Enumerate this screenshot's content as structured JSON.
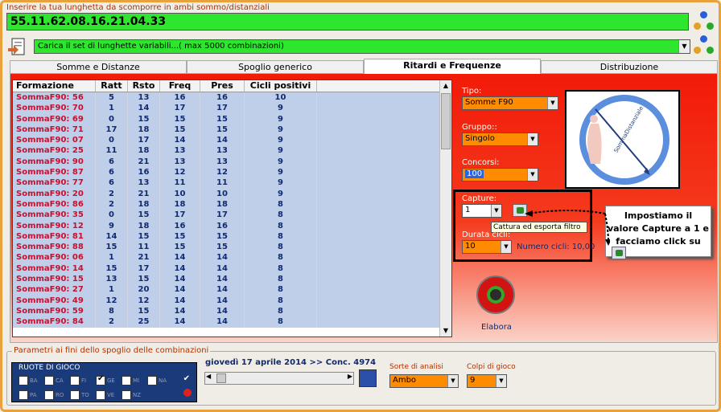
{
  "header": {
    "input_label": "Inserire la tua lunghetta da scomporre in ambi sommo/distanziali",
    "sequence_value": "55.11.62.08.16.21.04.33",
    "combo_value": "Carica il set di lunghette variabili...( max 5000 combinazioni)"
  },
  "tabs": [
    {
      "label": "Somme e Distanze"
    },
    {
      "label": "Spoglio generico"
    },
    {
      "label": "Ritardi e Frequenze"
    },
    {
      "label": "Distribuzione"
    }
  ],
  "table": {
    "columns": [
      "Formazione",
      "Ratt",
      "Rsto",
      "Freq",
      "Pres",
      "Cicli positivi"
    ],
    "rows": [
      [
        "SommaF90: 56",
        "5",
        "13",
        "16",
        "16",
        "10"
      ],
      [
        "SommaF90: 70",
        "1",
        "14",
        "17",
        "17",
        "9"
      ],
      [
        "SommaF90: 69",
        "0",
        "15",
        "15",
        "15",
        "9"
      ],
      [
        "SommaF90: 71",
        "17",
        "18",
        "15",
        "15",
        "9"
      ],
      [
        "SommaF90: 07",
        "0",
        "17",
        "14",
        "14",
        "9"
      ],
      [
        "SommaF90: 25",
        "11",
        "18",
        "13",
        "13",
        "9"
      ],
      [
        "SommaF90: 90",
        "6",
        "21",
        "13",
        "13",
        "9"
      ],
      [
        "SommaF90: 87",
        "6",
        "16",
        "12",
        "12",
        "9"
      ],
      [
        "SommaF90: 77",
        "6",
        "13",
        "11",
        "11",
        "9"
      ],
      [
        "SommaF90: 20",
        "2",
        "21",
        "10",
        "10",
        "9"
      ],
      [
        "SommaF90: 86",
        "2",
        "18",
        "18",
        "18",
        "8"
      ],
      [
        "SommaF90: 35",
        "0",
        "15",
        "17",
        "17",
        "8"
      ],
      [
        "SommaF90: 12",
        "9",
        "18",
        "16",
        "16",
        "8"
      ],
      [
        "SommaF90: 81",
        "14",
        "15",
        "15",
        "15",
        "8"
      ],
      [
        "SommaF90: 88",
        "15",
        "11",
        "15",
        "15",
        "8"
      ],
      [
        "SommaF90: 06",
        "1",
        "21",
        "14",
        "14",
        "8"
      ],
      [
        "SommaF90: 14",
        "15",
        "17",
        "14",
        "14",
        "8"
      ],
      [
        "SommaF90: 15",
        "13",
        "15",
        "14",
        "14",
        "8"
      ],
      [
        "SommaF90: 27",
        "1",
        "20",
        "14",
        "14",
        "8"
      ],
      [
        "SommaF90: 49",
        "12",
        "12",
        "14",
        "14",
        "8"
      ],
      [
        "SommaF90: 59",
        "8",
        "15",
        "14",
        "14",
        "8"
      ],
      [
        "SommaF90: 84",
        "2",
        "25",
        "14",
        "14",
        "8"
      ]
    ],
    "highlighted": [
      0,
      1,
      2,
      3,
      4,
      5,
      6,
      7,
      8,
      9,
      10,
      11,
      12,
      13,
      14,
      15,
      16,
      17,
      18,
      19,
      20,
      21
    ]
  },
  "filters": {
    "tipo_label": "Tipo:",
    "tipo_value": "Somme F90",
    "gruppo_label": "Gruppo::",
    "gruppo_value": "Singolo",
    "concorsi_label": "Concorsi:",
    "concorsi_value": "100",
    "capture_label": "Capture:",
    "capture_value": "1",
    "tooltip": "Cattura ed esporta filtro",
    "durata_label": "Durata cicli:",
    "durata_value": "10",
    "numero_cicli": "Numero cicli: 10,00"
  },
  "callout": "Impostiamo il valore Capture a 1 e facciamo click su",
  "diagram_label": "SommaDistanziale",
  "elabora_label": "Elabora",
  "bottom": {
    "legend": "Parametri ai fini dello spoglio delle combinazioni",
    "ruote_legend": "RUOTE DI GIOCO",
    "ruote": [
      "BA",
      "CA",
      "FI",
      "GE",
      "MI",
      "NA",
      "PA",
      "RO",
      "TO",
      "VE",
      "NZ"
    ],
    "ruote_checked": [
      "GE"
    ],
    "date_text": "giovedì 17 aprile 2014 >> Conc. 4974",
    "sorte_label": "Sorte di analisi",
    "sorte_value": "Ambo",
    "colpi_label": "Colpi di gioco",
    "colpi_value": "9"
  }
}
